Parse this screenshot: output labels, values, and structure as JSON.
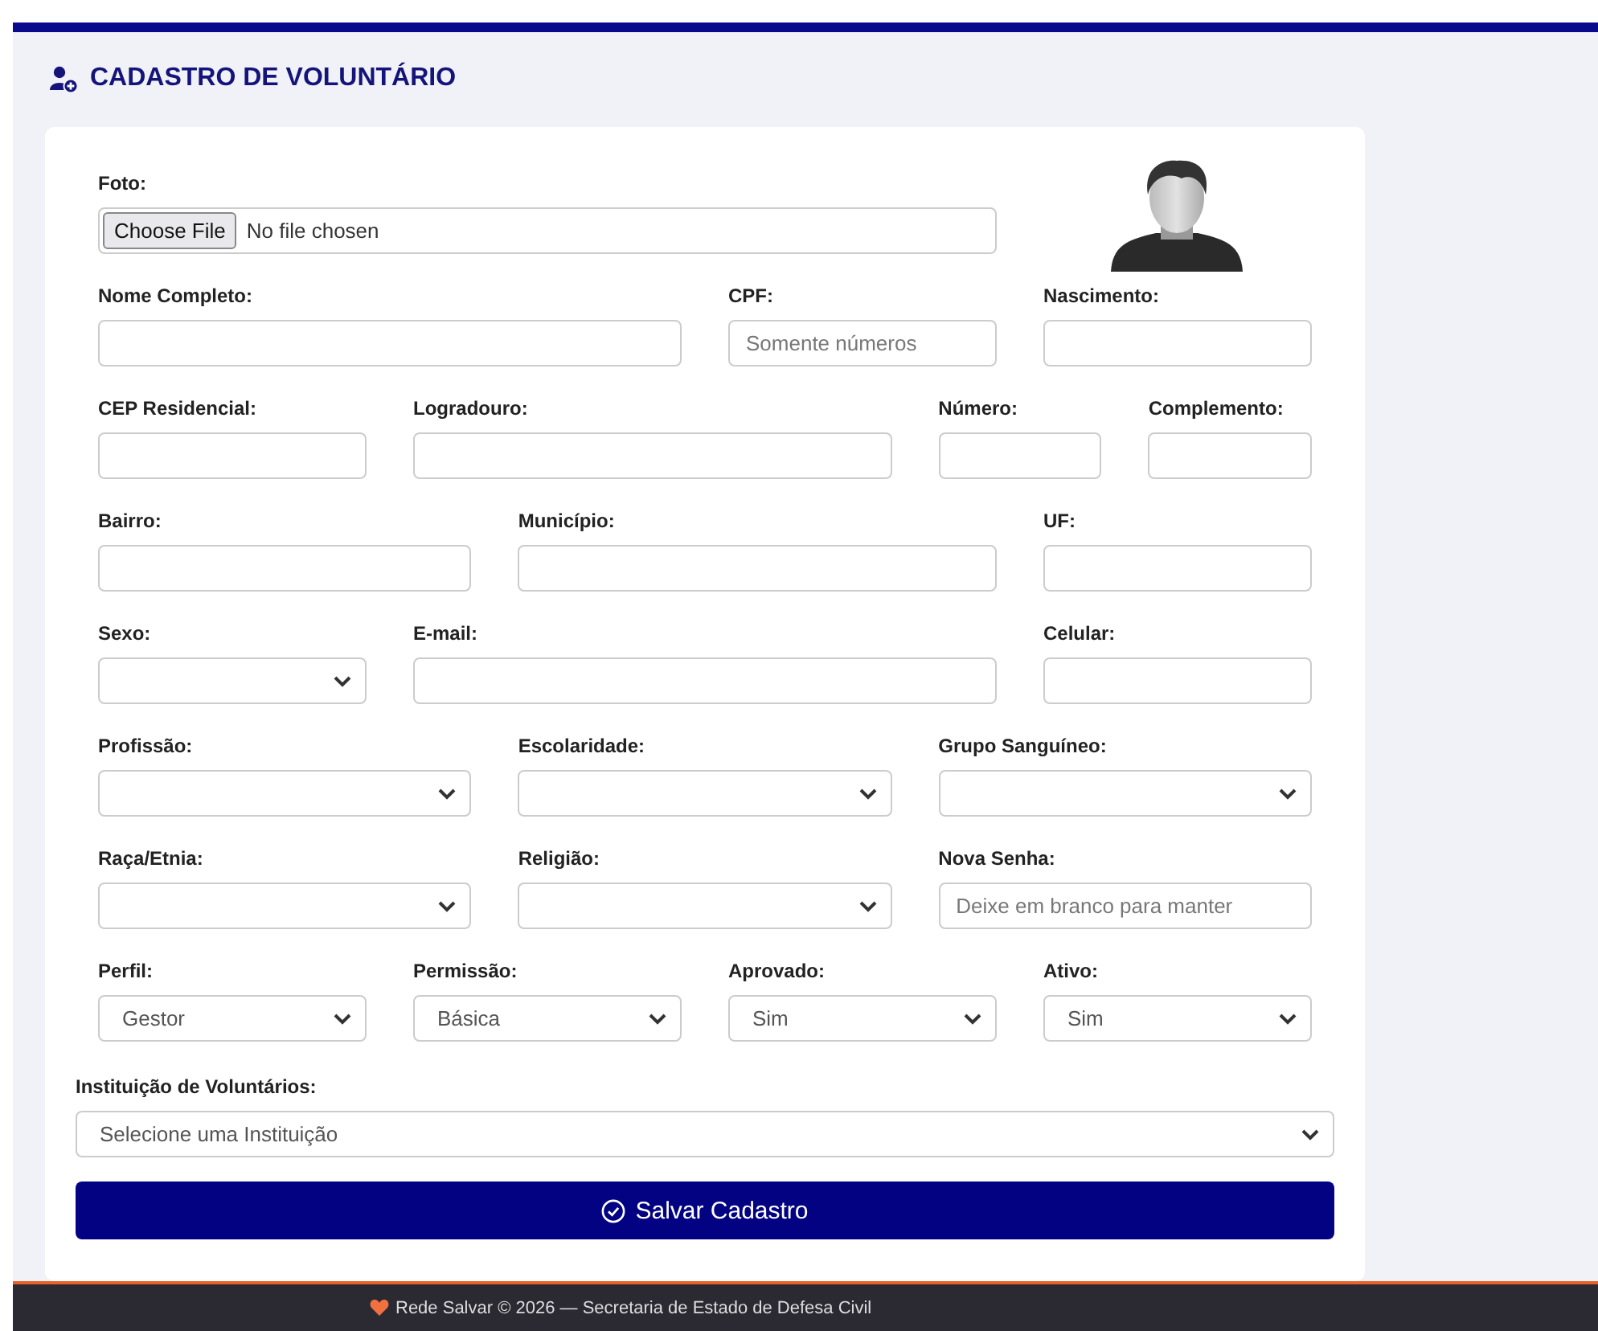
{
  "title": "CADASTRO DE VOLUNTÁRIO",
  "photo": {
    "label": "Foto:",
    "button": "Choose File",
    "status": "No file chosen"
  },
  "rows": [
    [
      {
        "label": "Nome Completo:",
        "kind": "text"
      },
      {
        "label": "CPF:",
        "kind": "text",
        "placeholder": "Somente números"
      },
      {
        "label": "Nascimento:",
        "kind": "text"
      }
    ],
    [
      {
        "label": "CEP Residencial:",
        "kind": "text"
      },
      {
        "label": "Logradouro:",
        "kind": "text"
      },
      {
        "label": "Número:",
        "kind": "text"
      },
      {
        "label": "Complemento:",
        "kind": "text"
      }
    ],
    [
      {
        "label": "Bairro:",
        "kind": "text"
      },
      {
        "label": "Município:",
        "kind": "text"
      },
      {
        "label": "UF:",
        "kind": "text"
      }
    ],
    [
      {
        "label": "Sexo:",
        "kind": "select"
      },
      {
        "label": "E-mail:",
        "kind": "text"
      },
      {
        "label": "Celular:",
        "kind": "text"
      }
    ],
    [
      {
        "label": "Profissão:",
        "kind": "select"
      },
      {
        "label": "Escolaridade:",
        "kind": "select"
      },
      {
        "label": "Grupo Sanguíneo:",
        "kind": "select"
      }
    ],
    [
      {
        "label": "Raça/Etnia:",
        "kind": "select"
      },
      {
        "label": "Religião:",
        "kind": "select"
      },
      {
        "label": "Nova Senha:",
        "kind": "text",
        "placeholder": "Deixe em branco para manter"
      }
    ],
    [
      {
        "label": "Perfil:",
        "kind": "select",
        "value": "Gestor"
      },
      {
        "label": "Permissão:",
        "kind": "select",
        "value": "Básica"
      },
      {
        "label": "Aprovado:",
        "kind": "select",
        "value": "Sim"
      },
      {
        "label": "Ativo:",
        "kind": "select",
        "value": "Sim"
      }
    ]
  ],
  "institution": {
    "label": "Instituição de Voluntários:",
    "value": "Selecione uma Instituição"
  },
  "submit": "Salvar Cadastro",
  "footer": "Rede Salvar © 2026 — Secretaria de Estado de Defesa Civil"
}
